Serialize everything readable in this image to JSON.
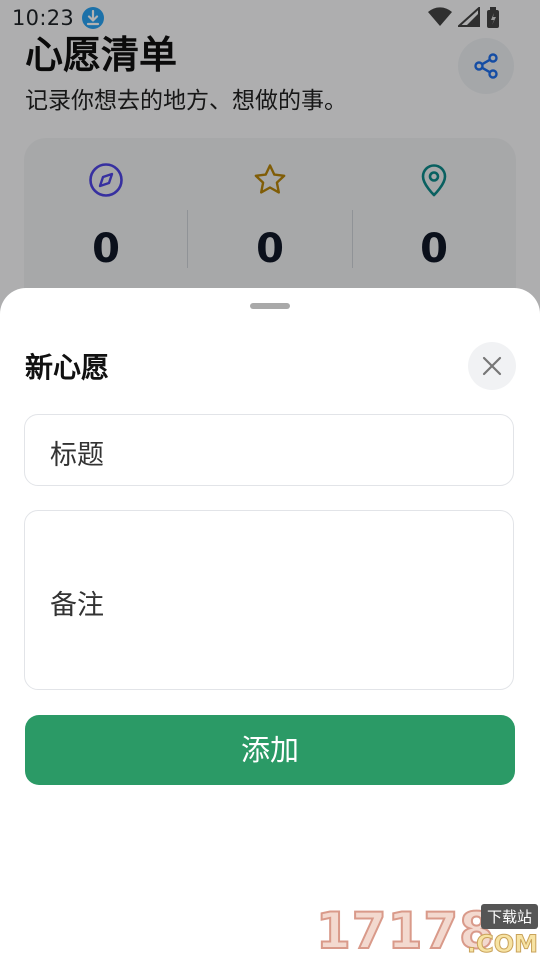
{
  "status_bar": {
    "time": "10:23"
  },
  "app": {
    "title": "心愿清单",
    "subtitle": "记录你想去的地方、想做的事。"
  },
  "stats": [
    {
      "icon": "compass-icon",
      "value": "0",
      "color": "#4f46e5"
    },
    {
      "icon": "star-icon",
      "value": "0",
      "color": "#b8860b"
    },
    {
      "icon": "map-pin-icon",
      "value": "0",
      "color": "#0e8a8a"
    }
  ],
  "sheet": {
    "title": "新心愿",
    "title_placeholder": "标题",
    "note_placeholder": "备注",
    "add_label": "添加"
  },
  "watermark": {
    "digits": "17178",
    "tag": "下载站",
    "suffix": ".COM"
  },
  "colors": {
    "primary": "#2b9a66",
    "share_icon": "#1f6feb"
  }
}
